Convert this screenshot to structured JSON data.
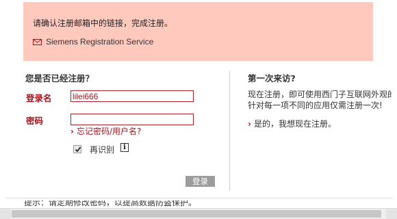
{
  "notice": {
    "message": "请确认注册邮箱中的链接，完成注册。",
    "service_name": "Siemens Registration Service",
    "icon": "mail-icon"
  },
  "login": {
    "heading": "您是否已经注册？",
    "username_label": "登录名",
    "username_value": "lilei666",
    "password_label": "密码",
    "password_value": "",
    "forgot_link": "忘记密码/用户名?",
    "remember_checked": true,
    "remember_label": "再识别",
    "info_icon": "i",
    "submit_label": "登录"
  },
  "first_visit": {
    "heading": "第一次来访?",
    "intro_line1": "现在注册，即可使用西门子互联网外观的",
    "intro_line2": "针对每一项不同的应用仅需注册一次!",
    "register_link": "是的，我想现在注册。"
  },
  "footer": {
    "hint": "提示：请定期修改密码，以提高数据防盗保护。"
  },
  "colors": {
    "notice_bg": "#ffc9be",
    "accent_red": "#a3131f",
    "button_gray": "#9c9c9c"
  }
}
